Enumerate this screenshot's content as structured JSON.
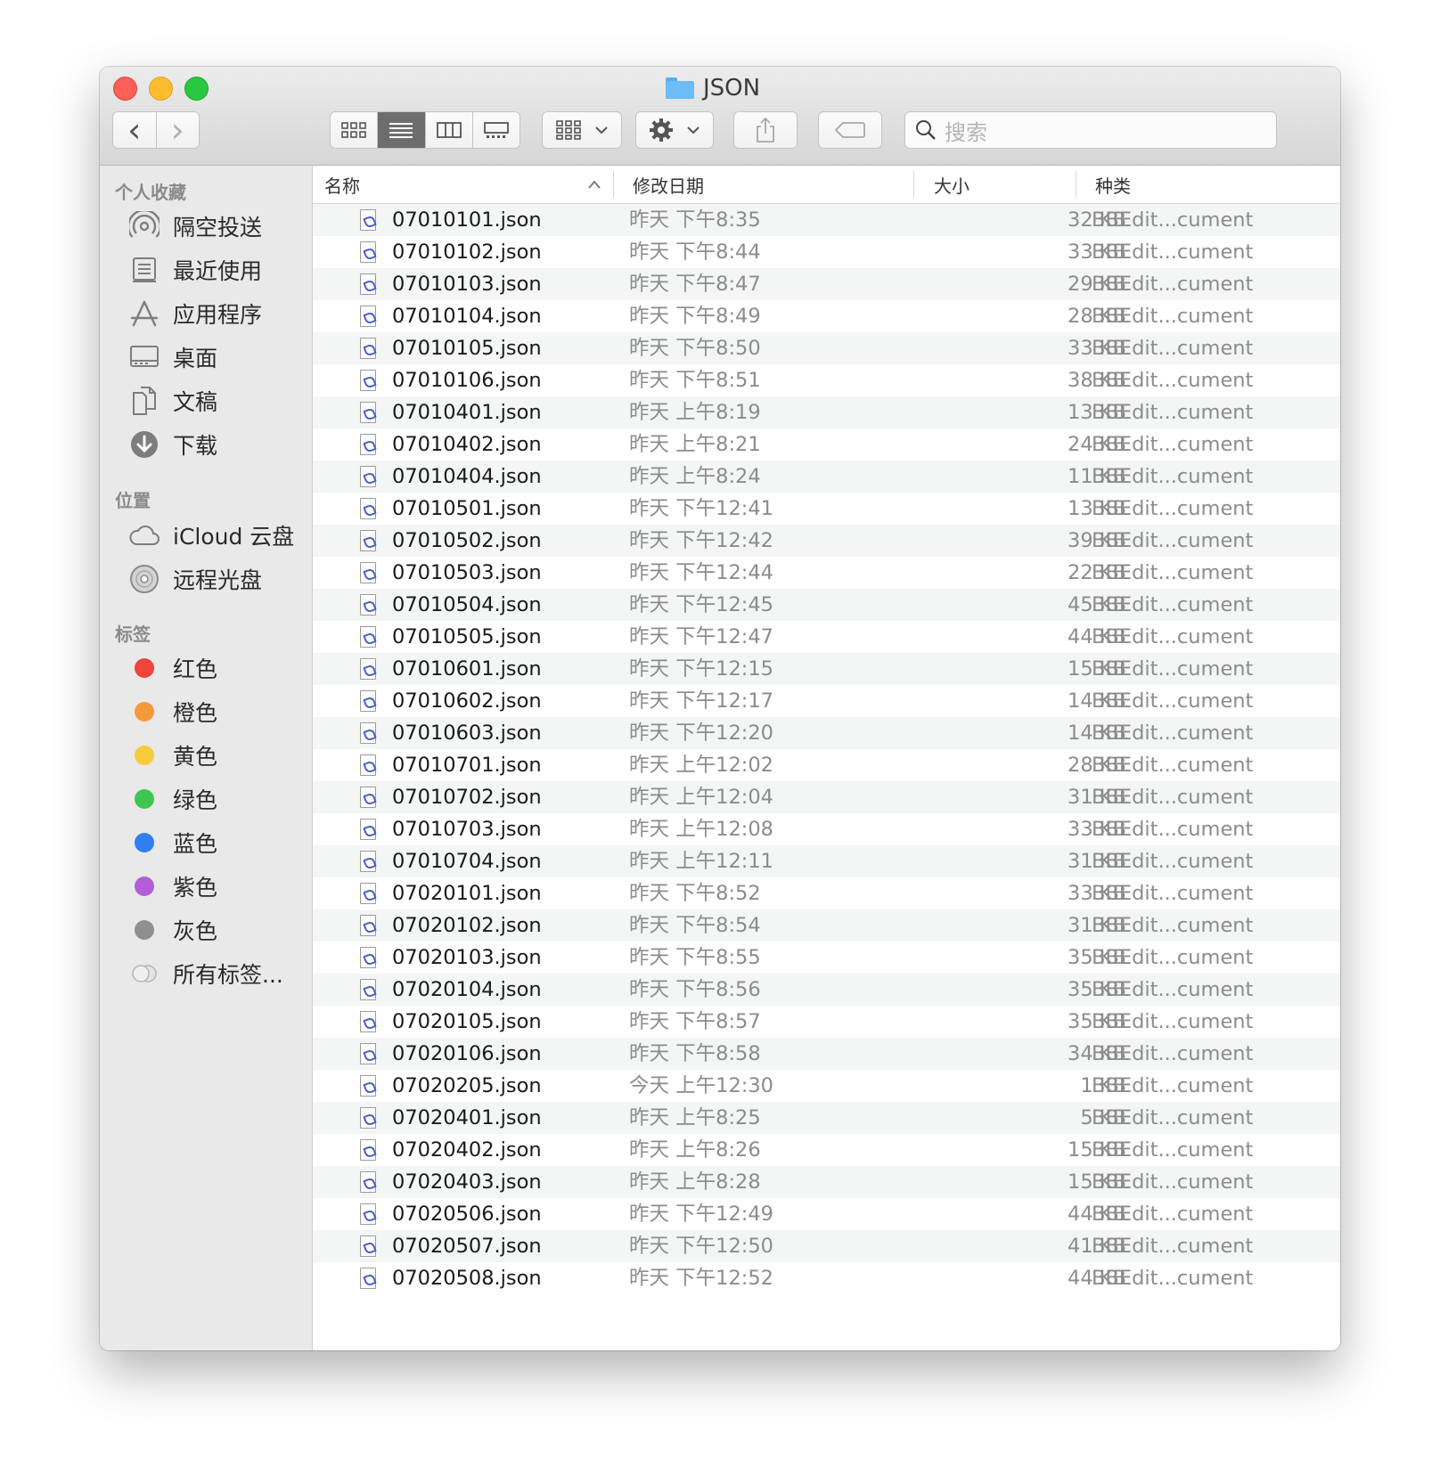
{
  "window": {
    "title": "JSON"
  },
  "toolbar": {
    "back_glyph": "‹",
    "forward_glyph": "›",
    "search_placeholder": "搜索"
  },
  "sidebar": {
    "favorites_header": "个人收藏",
    "favorites": [
      {
        "label": "隔空投送",
        "icon": "airdrop-icon"
      },
      {
        "label": "最近使用",
        "icon": "recents-icon"
      },
      {
        "label": "应用程序",
        "icon": "applications-icon"
      },
      {
        "label": "桌面",
        "icon": "desktop-icon"
      },
      {
        "label": "文稿",
        "icon": "documents-icon"
      },
      {
        "label": "下载",
        "icon": "downloads-icon"
      }
    ],
    "locations_header": "位置",
    "locations": [
      {
        "label": "iCloud 云盘",
        "icon": "icloud-icon"
      },
      {
        "label": "远程光盘",
        "icon": "remote-disc-icon"
      }
    ],
    "tags_header": "标签",
    "tags": [
      {
        "label": "红色",
        "color": "#f0443d"
      },
      {
        "label": "橙色",
        "color": "#f6993a"
      },
      {
        "label": "黄色",
        "color": "#f8cb3c"
      },
      {
        "label": "绿色",
        "color": "#3ec651"
      },
      {
        "label": "蓝色",
        "color": "#2f7ff0"
      },
      {
        "label": "紫色",
        "color": "#b35ed6"
      },
      {
        "label": "灰色",
        "color": "#8e8e93"
      },
      {
        "label": "所有标签...",
        "color": "#dcdcdc"
      }
    ]
  },
  "list": {
    "columns": {
      "name": "名称",
      "date": "修改日期",
      "size": "大小",
      "kind": "种类"
    },
    "rows": [
      {
        "name": "07010101.json",
        "date": "昨天 下午8:35",
        "size": "32 KB",
        "kind": "BBEdit...cument"
      },
      {
        "name": "07010102.json",
        "date": "昨天 下午8:44",
        "size": "33 KB",
        "kind": "BBEdit...cument"
      },
      {
        "name": "07010103.json",
        "date": "昨天 下午8:47",
        "size": "29 KB",
        "kind": "BBEdit...cument"
      },
      {
        "name": "07010104.json",
        "date": "昨天 下午8:49",
        "size": "28 KB",
        "kind": "BBEdit...cument"
      },
      {
        "name": "07010105.json",
        "date": "昨天 下午8:50",
        "size": "33 KB",
        "kind": "BBEdit...cument"
      },
      {
        "name": "07010106.json",
        "date": "昨天 下午8:51",
        "size": "38 KB",
        "kind": "BBEdit...cument"
      },
      {
        "name": "07010401.json",
        "date": "昨天 上午8:19",
        "size": "13 KB",
        "kind": "BBEdit...cument"
      },
      {
        "name": "07010402.json",
        "date": "昨天 上午8:21",
        "size": "24 KB",
        "kind": "BBEdit...cument"
      },
      {
        "name": "07010404.json",
        "date": "昨天 上午8:24",
        "size": "11 KB",
        "kind": "BBEdit...cument"
      },
      {
        "name": "07010501.json",
        "date": "昨天 下午12:41",
        "size": "13 KB",
        "kind": "BBEdit...cument"
      },
      {
        "name": "07010502.json",
        "date": "昨天 下午12:42",
        "size": "39 KB",
        "kind": "BBEdit...cument"
      },
      {
        "name": "07010503.json",
        "date": "昨天 下午12:44",
        "size": "22 KB",
        "kind": "BBEdit...cument"
      },
      {
        "name": "07010504.json",
        "date": "昨天 下午12:45",
        "size": "45 KB",
        "kind": "BBEdit...cument"
      },
      {
        "name": "07010505.json",
        "date": "昨天 下午12:47",
        "size": "44 KB",
        "kind": "BBEdit...cument"
      },
      {
        "name": "07010601.json",
        "date": "昨天 下午12:15",
        "size": "15 KB",
        "kind": "BBEdit...cument"
      },
      {
        "name": "07010602.json",
        "date": "昨天 下午12:17",
        "size": "14 KB",
        "kind": "BBEdit...cument"
      },
      {
        "name": "07010603.json",
        "date": "昨天 下午12:20",
        "size": "14 KB",
        "kind": "BBEdit...cument"
      },
      {
        "name": "07010701.json",
        "date": "昨天 上午12:02",
        "size": "28 KB",
        "kind": "BBEdit...cument"
      },
      {
        "name": "07010702.json",
        "date": "昨天 上午12:04",
        "size": "31 KB",
        "kind": "BBEdit...cument"
      },
      {
        "name": "07010703.json",
        "date": "昨天 上午12:08",
        "size": "33 KB",
        "kind": "BBEdit...cument"
      },
      {
        "name": "07010704.json",
        "date": "昨天 上午12:11",
        "size": "31 KB",
        "kind": "BBEdit...cument"
      },
      {
        "name": "07020101.json",
        "date": "昨天 下午8:52",
        "size": "33 KB",
        "kind": "BBEdit...cument"
      },
      {
        "name": "07020102.json",
        "date": "昨天 下午8:54",
        "size": "31 KB",
        "kind": "BBEdit...cument"
      },
      {
        "name": "07020103.json",
        "date": "昨天 下午8:55",
        "size": "35 KB",
        "kind": "BBEdit...cument"
      },
      {
        "name": "07020104.json",
        "date": "昨天 下午8:56",
        "size": "35 KB",
        "kind": "BBEdit...cument"
      },
      {
        "name": "07020105.json",
        "date": "昨天 下午8:57",
        "size": "35 KB",
        "kind": "BBEdit...cument"
      },
      {
        "name": "07020106.json",
        "date": "昨天 下午8:58",
        "size": "34 KB",
        "kind": "BBEdit...cument"
      },
      {
        "name": "07020205.json",
        "date": "今天 上午12:30",
        "size": "1 KB",
        "kind": "BBEdit...cument"
      },
      {
        "name": "07020401.json",
        "date": "昨天 上午8:25",
        "size": "5 KB",
        "kind": "BBEdit...cument"
      },
      {
        "name": "07020402.json",
        "date": "昨天 上午8:26",
        "size": "15 KB",
        "kind": "BBEdit...cument"
      },
      {
        "name": "07020403.json",
        "date": "昨天 上午8:28",
        "size": "15 KB",
        "kind": "BBEdit...cument"
      },
      {
        "name": "07020506.json",
        "date": "昨天 下午12:49",
        "size": "44 KB",
        "kind": "BBEdit...cument"
      },
      {
        "name": "07020507.json",
        "date": "昨天 下午12:50",
        "size": "41 KB",
        "kind": "BBEdit...cument"
      },
      {
        "name": "07020508.json",
        "date": "昨天 下午12:52",
        "size": "44 KB",
        "kind": "BBEdit...cument"
      }
    ]
  }
}
